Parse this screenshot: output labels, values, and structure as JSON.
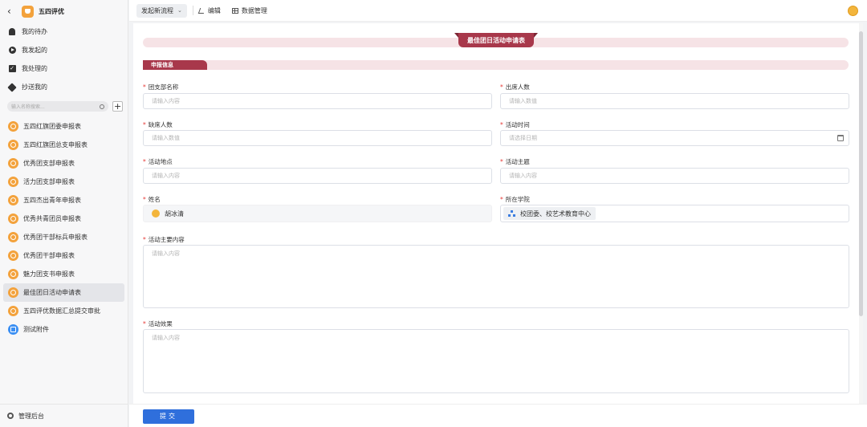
{
  "app": {
    "title": "五四评优"
  },
  "nav": [
    {
      "label": "我的待办",
      "icon": "bell-icon"
    },
    {
      "label": "我发起的",
      "icon": "play-icon"
    },
    {
      "label": "我处理的",
      "icon": "check-icon"
    },
    {
      "label": "抄送我的",
      "icon": "tag-icon"
    }
  ],
  "search": {
    "placeholder": "输入名称搜索..."
  },
  "forms": [
    {
      "label": "五四红旗团委申报表"
    },
    {
      "label": "五四红旗团总支申报表"
    },
    {
      "label": "优秀团支部申报表"
    },
    {
      "label": "活力团支部申报表"
    },
    {
      "label": "五四杰出青年申报表"
    },
    {
      "label": "优秀共青团员申报表"
    },
    {
      "label": "优秀团干部标兵申报表"
    },
    {
      "label": "优秀团干部申报表"
    },
    {
      "label": "魅力团支书申报表"
    },
    {
      "label": "最佳团日活动申请表",
      "active": true
    },
    {
      "label": "五四评优数据汇总提交审批"
    },
    {
      "label": "测试附件"
    }
  ],
  "footer": {
    "admin_label": "管理后台"
  },
  "toolbar": {
    "start_flow": "发起新流程",
    "edit": "编辑",
    "data_manage": "数据管理"
  },
  "form": {
    "title": "最佳团日活动申请表",
    "section": "申报信息",
    "fields": {
      "branch_name": {
        "label": "团支部名称",
        "placeholder": "请输入内容"
      },
      "attendees": {
        "label": "出席人数",
        "placeholder": "请输入数值"
      },
      "absentees": {
        "label": "缺席人数",
        "placeholder": "请输入数值"
      },
      "activity_time": {
        "label": "活动时间",
        "placeholder": "请选择日期"
      },
      "location": {
        "label": "活动地点",
        "placeholder": "请输入内容"
      },
      "theme": {
        "label": "活动主题",
        "placeholder": "请输入内容"
      },
      "name": {
        "label": "姓名",
        "value": "胡冰清"
      },
      "college": {
        "label": "所在学院",
        "value": "校团委、校艺术教育中心"
      },
      "content": {
        "label": "活动主要内容",
        "placeholder": "请输入内容"
      },
      "effect": {
        "label": "活动效果",
        "placeholder": "请输入内容"
      }
    },
    "required_mark": "*",
    "submit": "提交"
  }
}
